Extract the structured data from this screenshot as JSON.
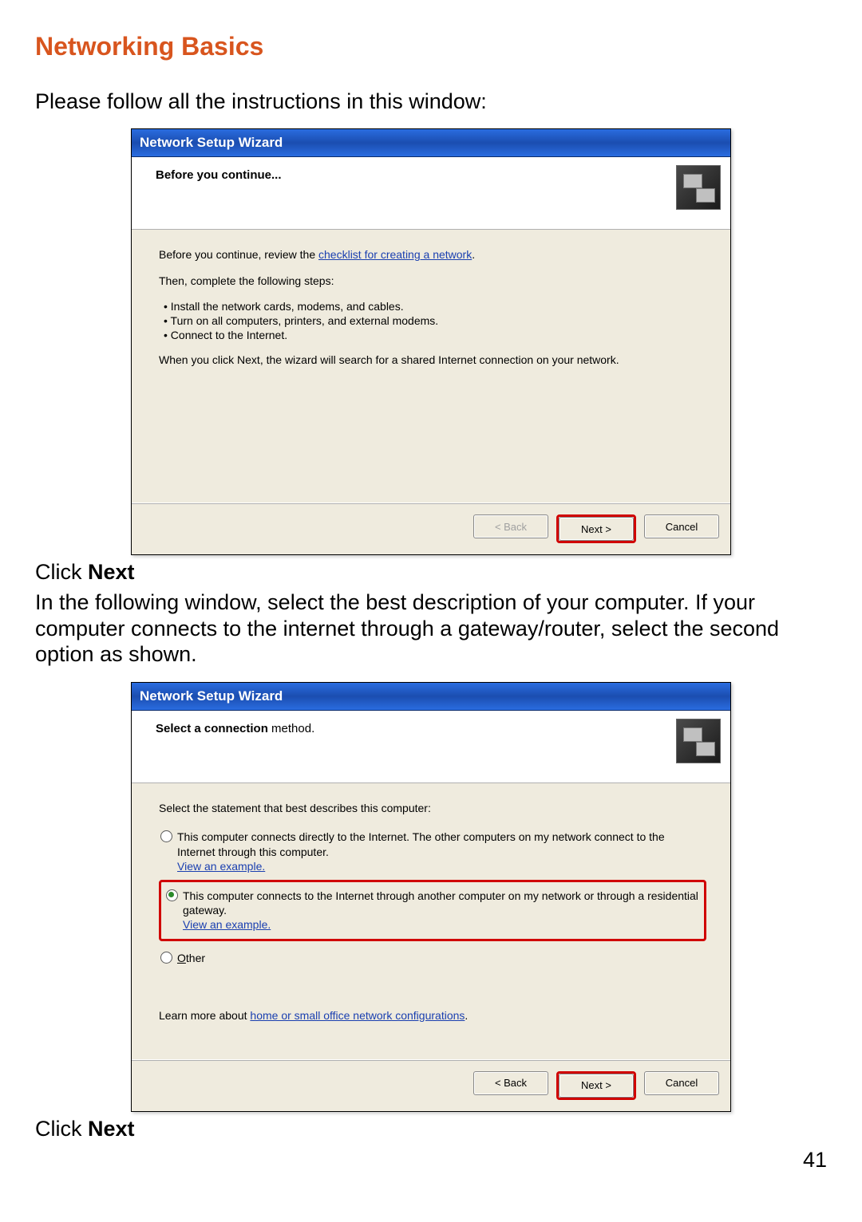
{
  "heading": "Networking Basics",
  "intro": "Please follow all the instructions in this window:",
  "click_next_prefix": "Click ",
  "click_next_bold": "Next",
  "paragraph2": "In the following window, select the best description of your computer. If your computer connects to the internet through a gateway/router, select the second option as shown.",
  "page_number": "41",
  "wizard1": {
    "titlebar": "Network Setup Wizard",
    "header_title": "Before you continue...",
    "line1_pre": "Before you continue, review the ",
    "line1_link": "checklist for creating a network",
    "line2": "Then, complete the following steps:",
    "bullet1": "Install the network cards, modems, and cables.",
    "bullet2": "Turn on all computers, printers, and external modems.",
    "bullet3": "Connect to the Internet.",
    "line3": "When you click Next, the wizard will search for a shared Internet connection on your network.",
    "btn_back": "< Back",
    "btn_next": "Next >",
    "btn_cancel": "Cancel"
  },
  "wizard2": {
    "titlebar": "Network Setup Wizard",
    "header_title_bold": "Select a connection",
    "header_title_rest": " method.",
    "prompt": "Select the statement that best describes this computer:",
    "opt1": "This computer connects directly to the Internet. The other computers on my network connect to the Internet through this computer.",
    "opt1_link": "View an example.",
    "opt2": "This computer connects to the Internet through another computer on my network or through a residential gateway.",
    "opt2_link": "View an example.",
    "opt3": "Other",
    "learn_pre": "Learn more about ",
    "learn_link": "home or small office network configurations",
    "btn_back": "< Back",
    "btn_next": "Next >",
    "btn_cancel": "Cancel"
  }
}
